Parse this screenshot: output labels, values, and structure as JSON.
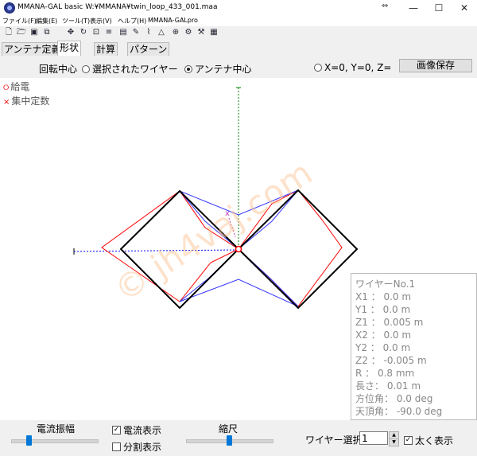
{
  "window": {
    "title": "MMANA-GAL basic  W:¥MMANA¥twin_loop_433_001.maa",
    "minimize": "—",
    "maximize": "☐",
    "close": "✕"
  },
  "menu": {
    "file": "ファイル(F)",
    "edit": "編集(E)",
    "tools": "ツール(T)",
    "view": "表示(V)",
    "help": "ヘルプ(H)",
    "pro": "MMANA-GALpro"
  },
  "tabs": [
    "アンテナ定義",
    "形状",
    "計算",
    "パターン"
  ],
  "options": {
    "rotation_label": "回転中心",
    "selected_wire": "選択されたワイヤー",
    "antenna_center": "アンテナ中心",
    "origin": "X=0, Y=0, Z=",
    "save_image": "画像保存"
  },
  "legend": {
    "feed": "給電",
    "lumped": "集中定数"
  },
  "watermark": "© jh4vaj.com",
  "wire_info": {
    "title": "ワイヤーNo.1",
    "x1": "X1  ： 0.0 m",
    "y1": "Y1  ： 0.0 m",
    "z1": "Z1  ： 0.005 m",
    "x2": "X2  ： 0.0 m",
    "y2": "Y2  ： 0.0 m",
    "z2": "Z2  ： -0.005 m",
    "r": "R   ： 0.8 mm",
    "length": "長さ： 0.01 m",
    "azimuth": "方位角： 0.0 deg",
    "zenith": "天頂角： -90.0 deg"
  },
  "bottom": {
    "current_amp": "電流振幅",
    "current_amp_level": 0.2,
    "current_display": "電流表示",
    "current_display_checked": true,
    "split_display": "分割表示",
    "split_display_checked": false,
    "scale": "縮尺",
    "scale_level": 0.5,
    "wire_select": "ワイヤー選択",
    "wire_select_value": "1",
    "bold_display": "太く表示",
    "bold_display_checked": true
  },
  "colors": {
    "wire": "#000000",
    "current_red": "#ff0000",
    "current_blue": "#0000ff",
    "axis_green": "#008000",
    "feed_point": "#ff0000"
  }
}
